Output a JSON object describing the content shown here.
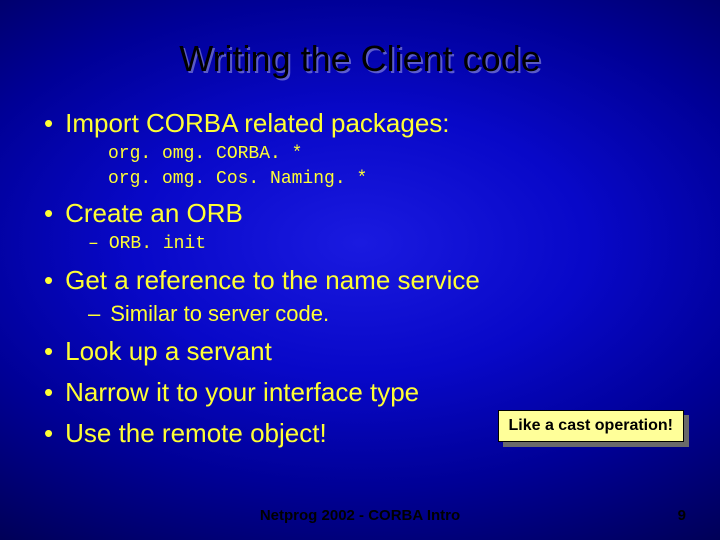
{
  "title": "Writing the Client code",
  "bullets": {
    "b0": "Import CORBA related packages:",
    "code0a": "org. omg. CORBA. *",
    "code0b": "org. omg. Cos. Naming. *",
    "b1": "Create an ORB",
    "sub1": "ORB. init",
    "b2": "Get a reference to the name service",
    "sub2": "Similar to server code.",
    "b3": "Look up a servant",
    "b4": "Narrow it to your interface type",
    "b5": "Use the remote object!"
  },
  "callout": "Like a cast operation!",
  "footer": "Netprog 2002  -  CORBA Intro",
  "page": "9"
}
